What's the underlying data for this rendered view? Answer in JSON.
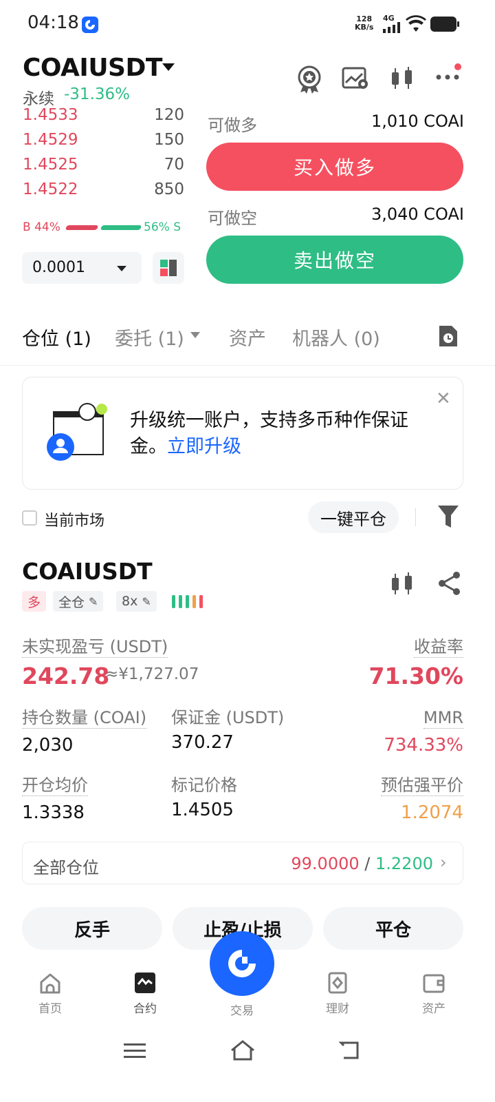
{
  "status_bar": {
    "time": "04:18",
    "speed_top": "128",
    "speed_unit": "KB/s",
    "network": "4G"
  },
  "header": {
    "symbol": "COAIUSDT",
    "type": "永续",
    "change": "-31.36%"
  },
  "orderbook": {
    "asks": [
      {
        "price": "1.4533",
        "qty": "120"
      },
      {
        "price": "1.4529",
        "qty": "150"
      },
      {
        "price": "1.4525",
        "qty": "70"
      },
      {
        "price": "1.4522",
        "qty": "850"
      }
    ],
    "buy_ratio": "B 44%",
    "sell_ratio": "56% S",
    "step": "0.0001"
  },
  "trade": {
    "long_avail_label": "可做多",
    "long_avail_value": "1,010 COAI",
    "long_button": "买入做多",
    "short_avail_label": "可做空",
    "short_avail_value": "3,040 COAI",
    "short_button": "卖出做空"
  },
  "tabs": {
    "positions": "仓位 (1)",
    "orders": "委托 (1)",
    "assets": "资产",
    "bots": "机器人 (0)"
  },
  "banner": {
    "text": "升级统一账户，支持多币种作保证金。",
    "link": "立即升级"
  },
  "filter": {
    "current_market": "当前市场",
    "close_all": "一键平仓"
  },
  "position": {
    "symbol": "COAIUSDT",
    "side": "多",
    "margin_mode": "全仓",
    "leverage": "8x",
    "unrealized_label": "未实现盈亏 (USDT)",
    "unrealized_value": "242.78",
    "unrealized_cny": "≈¥1,727.07",
    "roe_label": "收益率",
    "roe_value": "71.30%",
    "size_label": "持仓数量 (COAI)",
    "size_value": "2,030",
    "margin_label": "保证金 (USDT)",
    "margin_value": "370.27",
    "mmr_label": "MMR",
    "mmr_value": "734.33%",
    "entry_label": "开仓均价",
    "entry_value": "1.3338",
    "mark_label": "标记价格",
    "mark_value": "1.4505",
    "liq_label": "预估强平价",
    "liq_value": "1.2074",
    "all_positions_label": "全部仓位",
    "all_positions_tp": "99.0000",
    "all_positions_sep": "/",
    "all_positions_sl": "1.2200",
    "reverse": "反手",
    "tpsl": "止盈/止损",
    "close": "平仓"
  },
  "nav": {
    "home": "首页",
    "futures": "合约",
    "trade": "交易",
    "earn": "理财",
    "assets": "资产"
  },
  "colors": {
    "red": "#e0475c",
    "green": "#2ebd85",
    "blue": "#1a66ff",
    "orange": "#f0a04b"
  }
}
